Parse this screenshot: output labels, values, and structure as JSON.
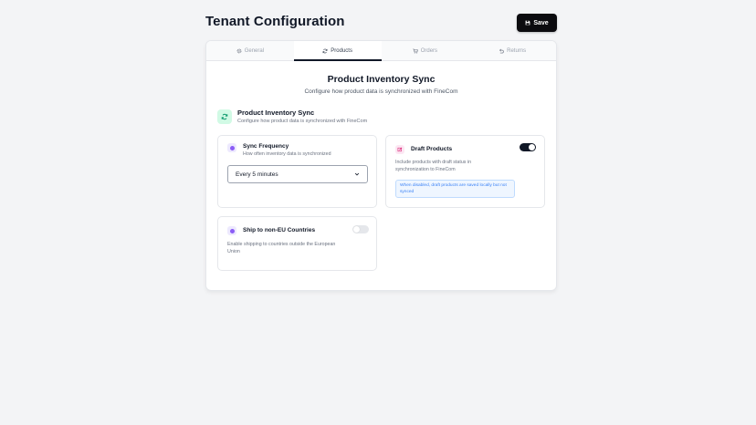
{
  "header": {
    "title": "Tenant Configuration",
    "save_label": "Save"
  },
  "tabs": [
    {
      "label": "General",
      "icon": "gear-icon",
      "active": false
    },
    {
      "label": "Products",
      "icon": "sync-icon",
      "active": true
    },
    {
      "label": "Orders",
      "icon": "cart-icon",
      "active": false
    },
    {
      "label": "Returns",
      "icon": "undo-icon",
      "active": false
    }
  ],
  "section": {
    "title": "Product Inventory Sync",
    "subtitle": "Configure how product data is synchronized with FineCom"
  },
  "group": {
    "title": "Product Inventory Sync",
    "subtitle": "Configure how product data is synchronized with FineCom"
  },
  "sync_frequency": {
    "title": "Sync Frequency",
    "subtitle": "How often inventory data is synchronized",
    "selected": "Every 5 minutes"
  },
  "draft_products": {
    "title": "Draft Products",
    "description": "Include products with draft status in synchronization to FineCom",
    "note": "When disabled, draft products are saved locally but not synced",
    "enabled": true
  },
  "shipping": {
    "title": "Ship to non-EU Countries",
    "description": "Enable shipping to countries outside the European Union",
    "enabled": false
  },
  "colors": {
    "accent": "#111827",
    "group_icon_bg": "#d1fae5",
    "note_bg": "#eff6ff"
  }
}
